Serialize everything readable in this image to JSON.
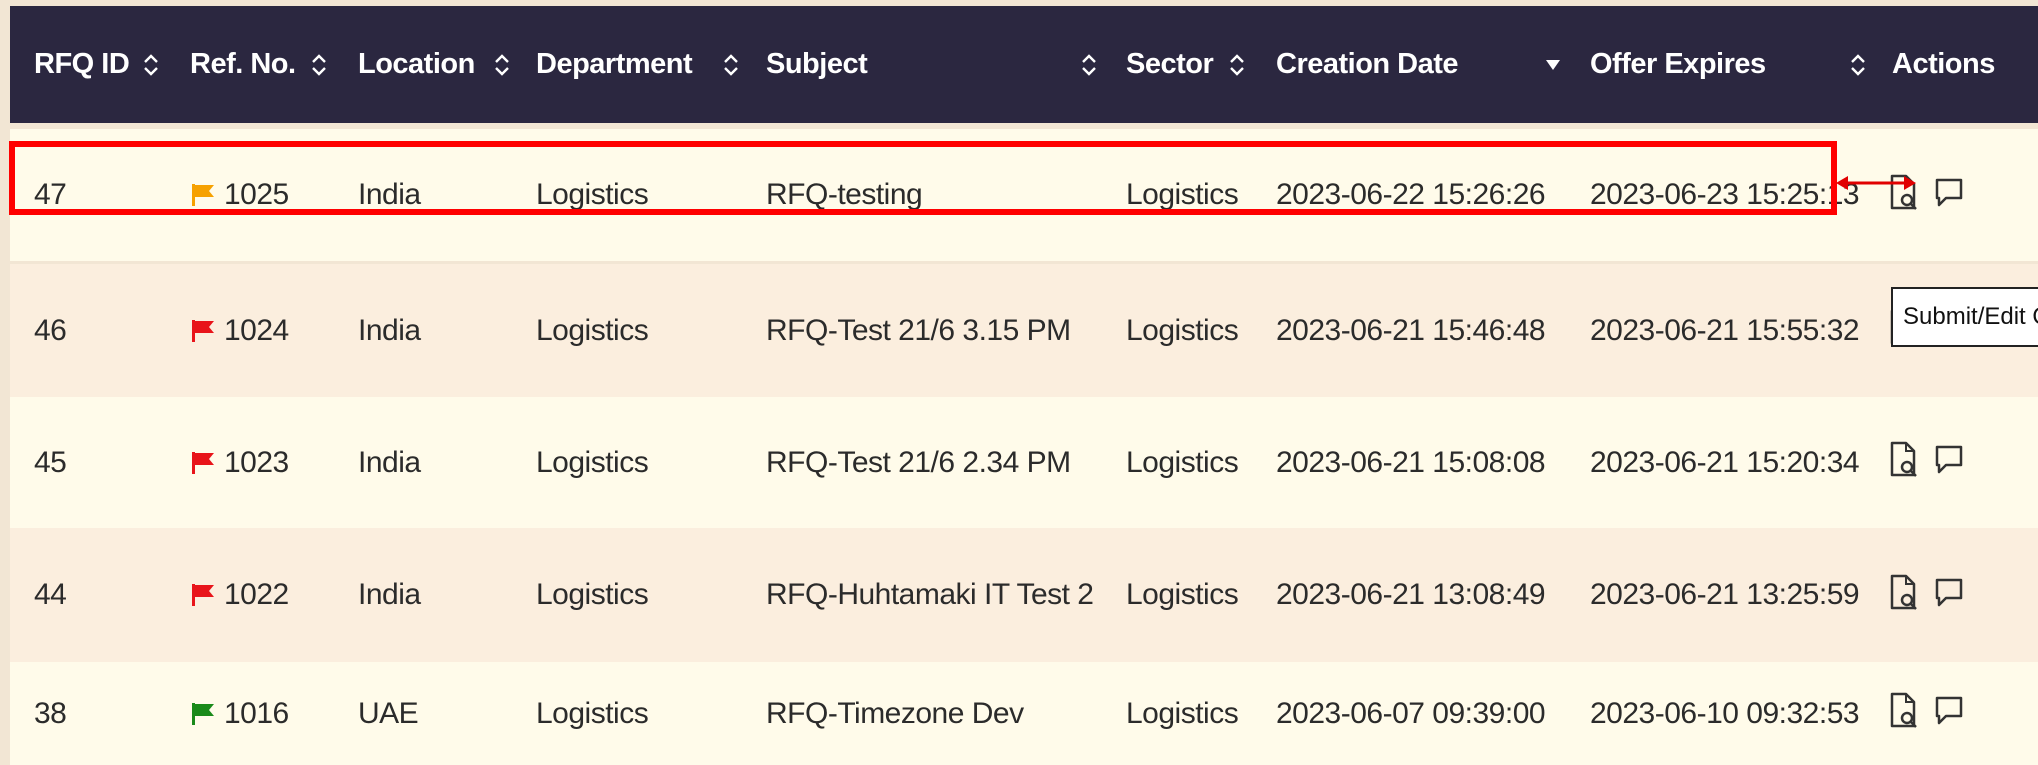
{
  "colors": {
    "header_bg": "#2b2740",
    "row_odd": "#fffbea",
    "row_even": "#fbeede",
    "highlight": "#ff0000",
    "flag_orange": "#f6a100",
    "flag_red": "#e8141a",
    "flag_green": "#1a8a1a"
  },
  "columns": [
    {
      "label": "RFQ ID",
      "sort": "both"
    },
    {
      "label": "Ref. No.",
      "sort": "both"
    },
    {
      "label": "Location",
      "sort": "both"
    },
    {
      "label": "Department",
      "sort": "both"
    },
    {
      "label": "Subject",
      "sort": "both"
    },
    {
      "label": "Sector",
      "sort": "both"
    },
    {
      "label": "Creation Date",
      "sort": "desc"
    },
    {
      "label": "Offer Expires",
      "sort": "both"
    },
    {
      "label": "Actions",
      "sort": "none"
    }
  ],
  "rows": [
    {
      "id": "47",
      "flag": "orange",
      "ref": "1025",
      "location": "India",
      "department": "Logistics",
      "subject": "RFQ-testing",
      "sector": "Logistics",
      "created": "2023-06-22 15:26:26",
      "expires": "2023-06-23 15:25:13"
    },
    {
      "id": "46",
      "flag": "red",
      "ref": "1024",
      "location": "India",
      "department": "Logistics",
      "subject": "RFQ-Test 21/6 3.15 PM",
      "sector": "Logistics",
      "created": "2023-06-21 15:46:48",
      "expires": "2023-06-21 15:55:32"
    },
    {
      "id": "45",
      "flag": "red",
      "ref": "1023",
      "location": "India",
      "department": "Logistics",
      "subject": "RFQ-Test 21/6 2.34 PM",
      "sector": "Logistics",
      "created": "2023-06-21 15:08:08",
      "expires": "2023-06-21 15:20:34"
    },
    {
      "id": "44",
      "flag": "red",
      "ref": "1022",
      "location": "India",
      "department": "Logistics",
      "subject": "RFQ-Huhtamaki IT Test 2",
      "sector": "Logistics",
      "created": "2023-06-21 13:08:49",
      "expires": "2023-06-21 13:25:59"
    },
    {
      "id": "38",
      "flag": "green",
      "ref": "1016",
      "location": "UAE",
      "department": "Logistics",
      "subject": "RFQ-Timezone Dev",
      "sector": "Logistics",
      "created": "2023-06-07 09:39:00",
      "expires": "2023-06-10 09:32:53"
    }
  ],
  "actions": [
    {
      "icon": "document-search-icon"
    },
    {
      "icon": "comment-icon"
    }
  ],
  "tooltip": {
    "text": "Submit/Edit Q"
  },
  "annotation": {
    "icon": "double-arrow-icon"
  }
}
